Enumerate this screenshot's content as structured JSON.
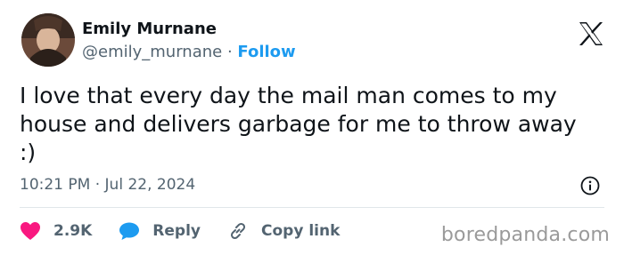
{
  "user": {
    "display_name": "Emily Murnane",
    "handle": "@emily_murnane",
    "separator": " · ",
    "follow_label": "Follow"
  },
  "tweet": {
    "text": "I love that every day the mail man comes to my\nhouse and delivers garbage for me to throw away\n:)",
    "timestamp": "10:21 PM · Jul 22, 2024"
  },
  "actions": {
    "like_count": "2.9K",
    "reply_label": "Reply",
    "copy_link_label": "Copy link"
  },
  "watermark": "boredpanda.com",
  "icons": {
    "logo": "x-logo-icon",
    "info": "info-icon",
    "like": "heart-icon",
    "reply": "speech-bubble-icon",
    "copy": "link-icon"
  },
  "colors": {
    "accent": "#1d9bf0",
    "like": "#f91880",
    "text": "#0f1419",
    "secondary": "#536471"
  }
}
